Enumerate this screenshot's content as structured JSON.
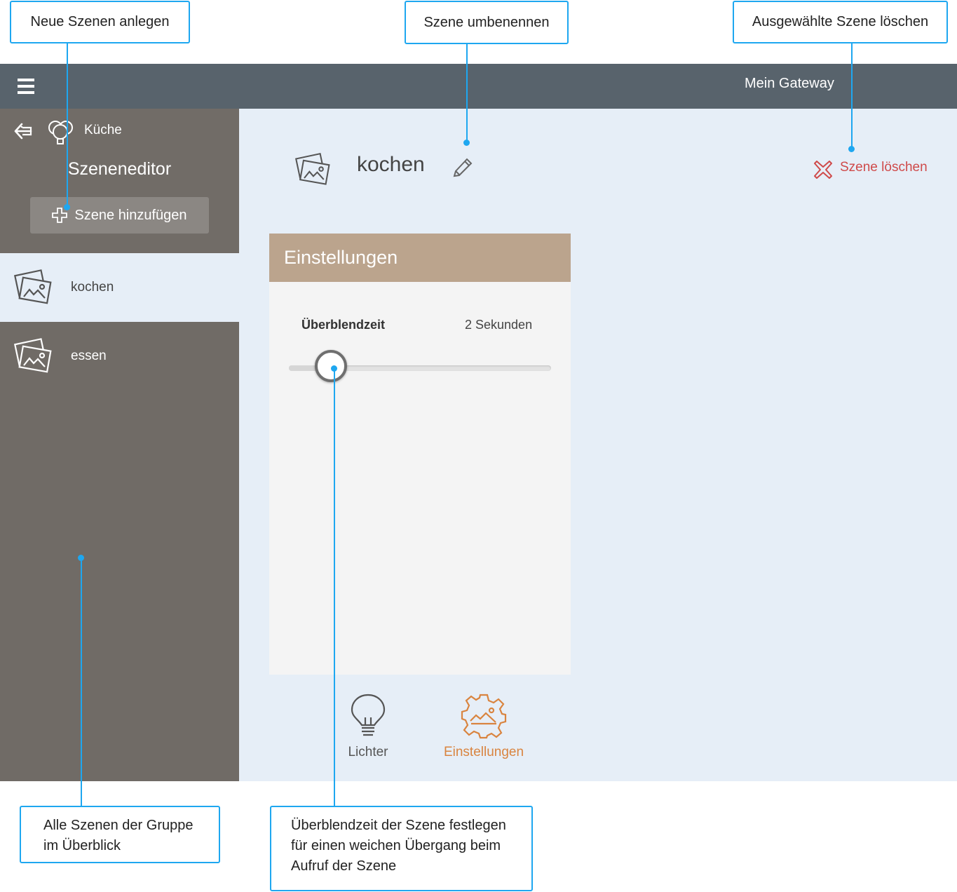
{
  "callouts": {
    "new_scenes": "Neue Szenen anlegen",
    "rename": "Szene umbenennen",
    "delete_selected": "Ausgewählte Szene löschen",
    "overview_line1": "Alle Szenen der Gruppe",
    "overview_line2": "im Überblick",
    "fade_line1": "Überblendzeit der Szene festlegen",
    "fade_line2": "für einen weichen Übergang beim",
    "fade_line3": "Aufruf der Szene"
  },
  "topbar": {
    "menu_icon": "hamburger-icon",
    "title": "Mein Gateway"
  },
  "sidebar": {
    "back_icon": "arrow-left-icon",
    "group_icon": "bulb-group-icon",
    "group_name": "Küche",
    "title": "Szeneneditor",
    "add_label": "Szene hinzufügen",
    "scenes": [
      {
        "label": "kochen",
        "active": true
      },
      {
        "label": "essen",
        "active": false
      }
    ]
  },
  "scene": {
    "name": "kochen",
    "edit_icon": "pencil-icon",
    "delete_label": "Szene löschen",
    "delete_color": "#cf4a4a"
  },
  "settings": {
    "title": "Einstellungen",
    "fade_label": "Überblendzeit",
    "fade_value": "2 Sekunden",
    "fade_slider_fraction": 0.17,
    "header_color": "#bba48d"
  },
  "tabs": [
    {
      "label": "Lichter",
      "icon": "lightbulb-icon",
      "active": false
    },
    {
      "label": "Einstellungen",
      "icon": "gear-scene-icon",
      "active": true,
      "color": "#d9843f"
    }
  ],
  "colors": {
    "callout_border": "#1ea7f0",
    "topbar": "#58636c",
    "sidebar": "#706b66",
    "main": "#e6eef7"
  }
}
